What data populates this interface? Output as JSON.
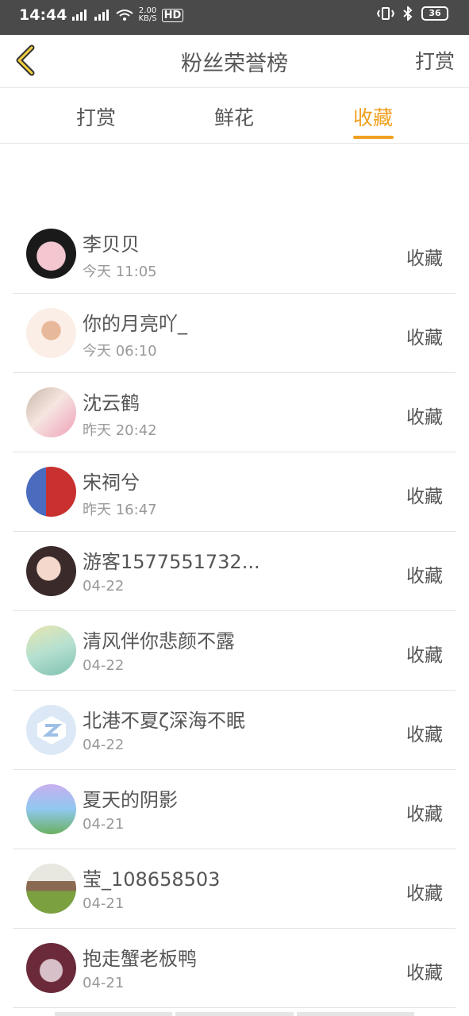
{
  "status_bar": {
    "time": "14:44",
    "net_speed_top": "2.00",
    "net_speed_bottom": "KB/S",
    "hd": "HD",
    "battery": "36"
  },
  "header": {
    "title": "粉丝荣誉榜",
    "right_action": "打赏"
  },
  "tabs": [
    {
      "label": "打赏"
    },
    {
      "label": "鲜花"
    },
    {
      "label": "收藏"
    }
  ],
  "active_tab": "收藏",
  "colors": {
    "accent": "#f0a020",
    "text": "#555555",
    "subtext": "#999999"
  },
  "fans": [
    {
      "name": "李贝贝",
      "time": "今天 11:05",
      "action": "收藏"
    },
    {
      "name": "你的月亮吖_",
      "time": "今天 06:10",
      "action": "收藏"
    },
    {
      "name": "沈云鹤",
      "time": "昨天 20:42",
      "action": "收藏"
    },
    {
      "name": "宋祠兮",
      "time": "昨天 16:47",
      "action": "收藏"
    },
    {
      "name": "游客1577551732...",
      "time": "04-22",
      "action": "收藏"
    },
    {
      "name": "清风伴你悲颜不露",
      "time": "04-22",
      "action": "收藏"
    },
    {
      "name": "北港不夏ζ深海不眠",
      "time": "04-22",
      "action": "收藏"
    },
    {
      "name": "夏天的阴影",
      "time": "04-21",
      "action": "收藏"
    },
    {
      "name": "莹_108658503",
      "time": "04-21",
      "action": "收藏"
    },
    {
      "name": "抱走蟹老板鸭",
      "time": "04-21",
      "action": "收藏"
    }
  ]
}
